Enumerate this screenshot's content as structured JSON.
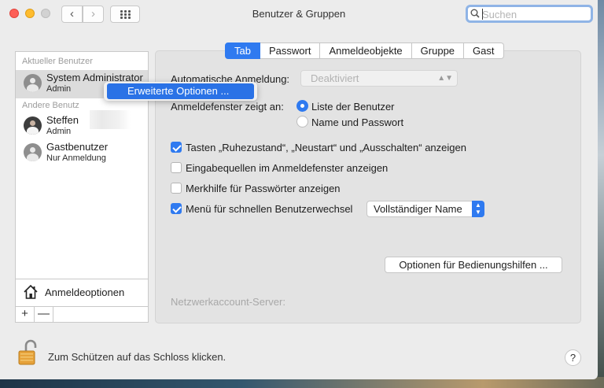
{
  "window": {
    "title": "Benutzer & Gruppen",
    "nav_back": "‹",
    "nav_forward": "›"
  },
  "search": {
    "placeholder": "Suchen",
    "value": ""
  },
  "sidebar": {
    "current_section": "Aktueller Benutzer",
    "other_section": "Andere Benutz",
    "users": [
      {
        "name": "System Administrator",
        "role": "Admin",
        "avatar": "generic"
      },
      {
        "name": "Steffen",
        "role": "Admin",
        "avatar": "photo"
      },
      {
        "name": "Gastbenutzer",
        "role": "Nur Anmeldung",
        "avatar": "generic"
      }
    ],
    "login_options_label": "Anmeldeoptionen",
    "add_label": "+",
    "remove_label": "—"
  },
  "context_menu": {
    "item": "Erweiterte Optionen ..."
  },
  "tabs": [
    {
      "label": "Tab",
      "active": true
    },
    {
      "label": "Passwort",
      "active": false
    },
    {
      "label": "Anmeldeobjekte",
      "active": false
    },
    {
      "label": "Gruppe",
      "active": false
    },
    {
      "label": "Gast",
      "active": false
    }
  ],
  "settings": {
    "auto_login_label": "Automatische Anmeldung:",
    "auto_login_value": "Deaktiviert",
    "login_window_label": "Anmeldefenster zeigt an:",
    "radio_list_label": "Liste der Benutzer",
    "radio_list_selected": true,
    "radio_name_label": "Name und Passwort",
    "radio_name_selected": false,
    "checkboxes": [
      {
        "label": "Tasten „Ruhezustand“, „Neustart“ und „Ausschalten“ anzeigen",
        "checked": true
      },
      {
        "label": "Eingabequellen im Anmeldefenster anzeigen",
        "checked": false
      },
      {
        "label": "Merkhilfe für Passwörter anzeigen",
        "checked": false
      },
      {
        "label": "Menü für schnellen Benutzerwechsel",
        "checked": true
      }
    ],
    "fast_switch_value": "Vollständiger Name",
    "accessibility_button": "Optionen für Bedienungshilfen ...",
    "network_server_label": "Netzwerkaccount-Server:"
  },
  "footer": {
    "lock_text": "Zum Schützen auf das Schloss klicken.",
    "help_label": "?"
  },
  "colors": {
    "accent": "#2f7af0",
    "menu_highlight": "#2a72e6"
  },
  "icons": [
    "search-icon",
    "grid-icon",
    "house-icon",
    "lock-open-icon",
    "user-avatar-icon"
  ]
}
